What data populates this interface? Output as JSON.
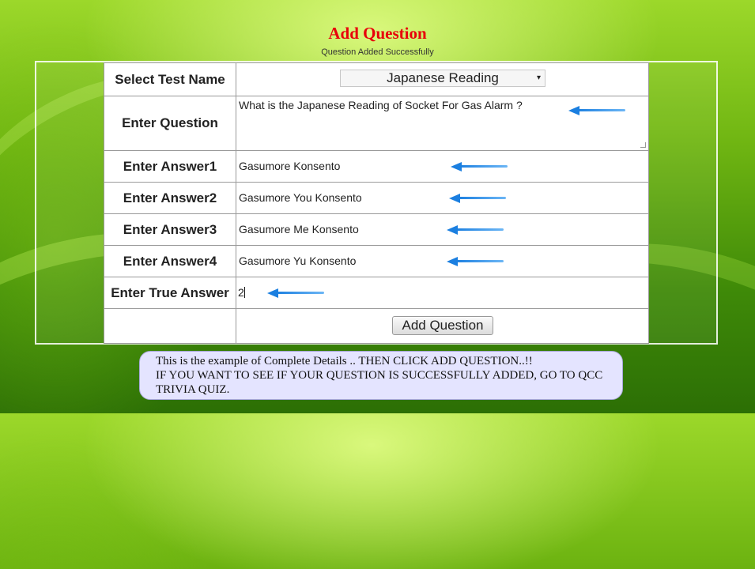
{
  "page": {
    "title": "Add Question",
    "status_message": "Question Added Successfully"
  },
  "form": {
    "test_name": {
      "label": "Select Test Name",
      "selected": "Japanese Reading"
    },
    "question": {
      "label": "Enter Question",
      "value": "What is the Japanese Reading of Socket For Gas Alarm ?"
    },
    "answers": [
      {
        "label": "Enter Answer1",
        "value": "Gasumore Konsento"
      },
      {
        "label": "Enter Answer2",
        "value": "Gasumore You Konsento"
      },
      {
        "label": "Enter Answer3",
        "value": "Gasumore Me Konsento"
      },
      {
        "label": "Enter Answer4",
        "value": "Gasumore Yu Konsento"
      }
    ],
    "true_answer": {
      "label": "Enter True Answer",
      "value": "2"
    },
    "submit_label": "Add Question"
  },
  "annotations": {
    "arrow_color": "#1b7fe0",
    "note_line1": "This is the example of Complete Details .. THEN CLICK ADD QUESTION..!!",
    "note_line2": "IF YOU WANT TO SEE IF YOUR QUESTION IS SUCCESSFULLY ADDED, GO TO QCC TRIVIA QUIZ."
  },
  "colors": {
    "title": "#e8000a",
    "background_green": "#6fb512",
    "note_background": "#e4e4ff"
  }
}
